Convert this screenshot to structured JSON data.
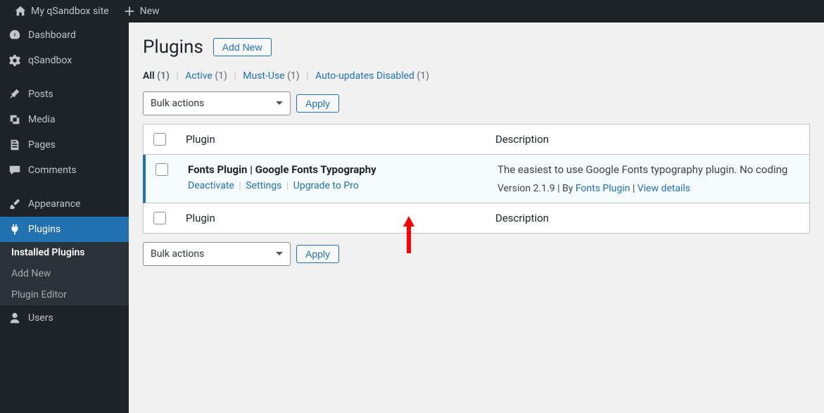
{
  "topbar": {
    "siteName": "My qSandbox site",
    "newLabel": "New"
  },
  "sidebar": {
    "items": [
      {
        "icon": "dashboard",
        "label": "Dashboard"
      },
      {
        "icon": "gear",
        "label": "qSandbox"
      },
      {
        "icon": "pin",
        "label": "Posts"
      },
      {
        "icon": "media",
        "label": "Media"
      },
      {
        "icon": "pages",
        "label": "Pages"
      },
      {
        "icon": "comment",
        "label": "Comments"
      },
      {
        "icon": "brush",
        "label": "Appearance"
      },
      {
        "icon": "plug",
        "label": "Plugins"
      },
      {
        "icon": "user",
        "label": "Users"
      }
    ],
    "submenu": {
      "installed": "Installed Plugins",
      "addNew": "Add New",
      "editor": "Plugin Editor"
    }
  },
  "page": {
    "title": "Plugins",
    "addNew": "Add New"
  },
  "filters": {
    "all": {
      "label": "All",
      "count": "(1)"
    },
    "active": {
      "label": "Active",
      "count": "(1)"
    },
    "mustUse": {
      "label": "Must-Use",
      "count": "(1)"
    },
    "autoDisabled": {
      "label": "Auto-updates Disabled",
      "count": "(1)"
    }
  },
  "bulk": {
    "select": "Bulk actions",
    "apply": "Apply"
  },
  "table": {
    "headers": {
      "plugin": "Plugin",
      "description": "Description"
    }
  },
  "plugin": {
    "name": "Fonts Plugin | Google Fonts Typography",
    "actions": {
      "deactivate": "Deactivate",
      "settings": "Settings",
      "upgrade": "Upgrade to Pro"
    },
    "description": "The easiest to use Google Fonts typography plugin. No coding",
    "meta": {
      "version": "Version 2.1.9",
      "byLabel": "By",
      "author": "Fonts Plugin",
      "details": "View details"
    }
  }
}
